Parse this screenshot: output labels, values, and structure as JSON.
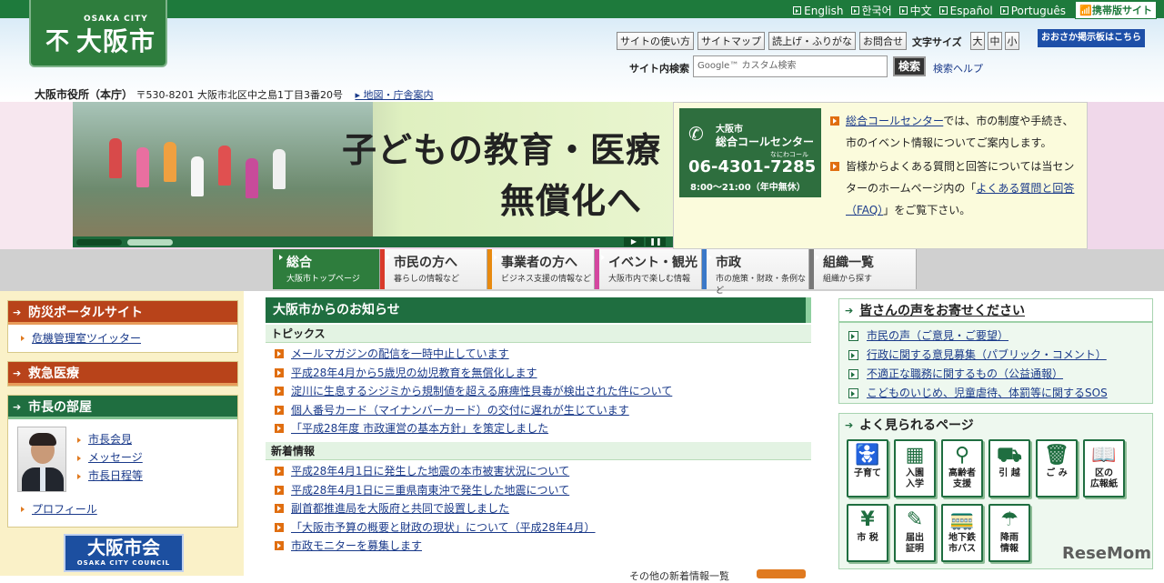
{
  "header": {
    "languages": [
      "English",
      "한국어",
      "中文",
      "Español",
      "Português"
    ],
    "mobile_site": "携帯版サイト",
    "logo_en": "OSAKA CITY",
    "logo_mark": "不",
    "logo_jp": "大阪市",
    "tools": [
      "サイトの使い方",
      "サイトマップ",
      "読上げ・ふりがな",
      "お問合せ"
    ],
    "font_size_label": "文字サイズ",
    "font_sizes": [
      "大",
      "中",
      "小"
    ],
    "bbs": "おおさか掲示板はこちら",
    "search_label": "サイト内検索",
    "search_placeholder": "Google™ カスタム検索",
    "search_button": "検索",
    "search_help": "検索ヘルプ",
    "address_name": "大阪市役所（本庁）",
    "address_text": "〒530-8201 大阪市北区中之島1丁目3番20号",
    "map_link": "地図・庁舎案内"
  },
  "banner": {
    "line1": "子どもの教育・医療",
    "line2": "無償化へ",
    "controls": [
      "▶",
      "❚❚"
    ]
  },
  "callcenter": {
    "name1": "大阪市",
    "name2": "総合コールセンター",
    "kana": "なにわコール",
    "number": "06-4301-7285",
    "hours": "8:00～21:00（年中無休）",
    "p1_link": "総合コールセンター",
    "p1_text": "では、市の制度や手続き、市のイベント情報についてご案内します。",
    "p2_text": "皆様からよくある質問と回答については当センターのホームページ内の「",
    "p2_link": "よくある質問と回答（FAQ）",
    "p2_end": "」をご覧下さい。"
  },
  "nav": [
    {
      "title": "総合",
      "sub": "大阪市トップページ",
      "color": "#2e7d3d"
    },
    {
      "title": "市民の方へ",
      "sub": "暮らしの情報など",
      "color": "#d93a2a"
    },
    {
      "title": "事業者の方へ",
      "sub": "ビジネス支援の情報など",
      "color": "#e88a10"
    },
    {
      "title": "イベント・観光",
      "sub": "大阪市内で楽しむ情報",
      "color": "#d447a0"
    },
    {
      "title": "市政",
      "sub": "市の施策・財政・条例など",
      "color": "#3a78c8"
    },
    {
      "title": "組織一覧",
      "sub": "組織から探す",
      "color": "#777777"
    }
  ],
  "left": {
    "disaster_title": "防災ポータルサイト",
    "disaster_link": "危機管理室ツイッター",
    "emergency_title": "救急医療",
    "mayor_title": "市長の部屋",
    "mayor_links": [
      "市長会見",
      "メッセージ",
      "市長日程等"
    ],
    "profile": "プロフィール",
    "council_jp": "大阪市会",
    "council_en": "OSAKA CITY COUNCIL"
  },
  "center": {
    "title": "大阪市からのお知らせ",
    "topics_title": "トピックス",
    "topics": [
      "メールマガジンの配信を一時中止しています",
      "平成28年4月から5歳児の幼児教育を無償化します",
      "淀川に生息するシジミから規制値を超える麻痺性貝毒が検出された件について",
      "個人番号カード（マイナンバーカード）の交付に遅れが生じています",
      "「平成28年度 市政運営の基本方針」を策定しました"
    ],
    "new_title": "新着情報",
    "news": [
      "平成28年4月1日に発生した地震の本市被害状況について",
      "平成28年4月1日に三重県南東沖で発生した地震について",
      "副首都推進局を大阪府と共同で設置しました",
      "「大阪市予算の概要と財政の現状」について（平成28年4月）",
      "市政モニターを募集します"
    ],
    "more": "その他の新着情報一覧"
  },
  "right": {
    "voice_title": "皆さんの声をお寄せください",
    "voice_links": [
      "市民の声（ご意見・ご要望）",
      "行政に関する意見募集（パブリック・コメント）",
      "不適正な職務に関するもの（公益通報）",
      "こどものいじめ、児童虐待、体罰等に関するSOS"
    ],
    "popular_title": "よく見られるページ",
    "tiles": [
      {
        "icon": "stroller-icon",
        "glyph": "🚼",
        "label": "子育て"
      },
      {
        "icon": "building-icon",
        "glyph": "▦",
        "label": "入園\n入学"
      },
      {
        "icon": "cane-icon",
        "glyph": "⚲",
        "label": "高齢者\n支援"
      },
      {
        "icon": "truck-icon",
        "glyph": "⛟",
        "label": "引 越"
      },
      {
        "icon": "trash-icon",
        "glyph": "🗑",
        "label": "ご み"
      },
      {
        "icon": "book-icon",
        "glyph": "📖",
        "label": "区の\n広報紙"
      },
      {
        "icon": "yen-icon",
        "glyph": "¥",
        "label": "市 税"
      },
      {
        "icon": "form-icon",
        "glyph": "✎",
        "label": "届出\n証明"
      },
      {
        "icon": "train-icon",
        "glyph": "🚃",
        "label": "地下鉄\n市バス"
      },
      {
        "icon": "umbrella-icon",
        "glyph": "☂",
        "label": "降雨\n情報"
      }
    ]
  },
  "watermark": "ReseMom"
}
